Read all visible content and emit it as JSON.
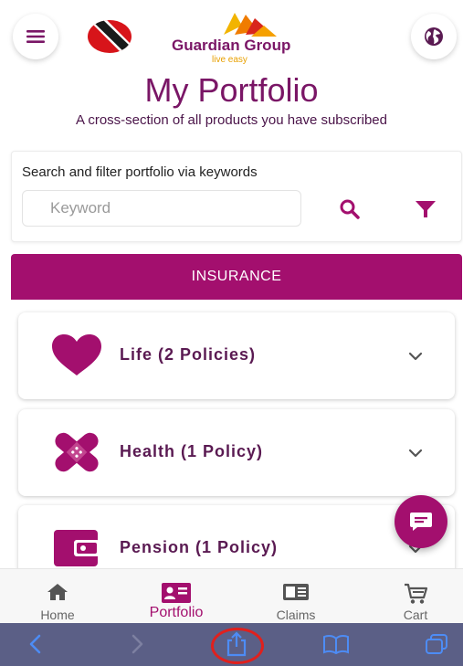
{
  "header": {
    "brand_name": "Guardian Group",
    "tagline": "live easy",
    "menu_icon": "hamburger-menu-icon",
    "globe_icon": "globe-icon",
    "flag_icon": "trinidad-flag-icon"
  },
  "page": {
    "title": "My Portfolio",
    "subtitle": "A cross-section of all products you have subscribed"
  },
  "search": {
    "label": "Search and filter portfolio via keywords",
    "placeholder": "Keyword",
    "value": "",
    "search_icon": "search-icon",
    "filter_icon": "filter-icon"
  },
  "tabs": {
    "active": "INSURANCE"
  },
  "policies": [
    {
      "name": "Life",
      "count": "(2 Policies)",
      "icon": "heart-icon"
    },
    {
      "name": "Health",
      "count": "(1 Policy)",
      "icon": "bandage-icon"
    },
    {
      "name": "Pension",
      "count": "(1 Policy)",
      "icon": "wallet-icon"
    }
  ],
  "fab": {
    "icon": "chat-icon"
  },
  "bottom_nav": [
    {
      "label": "Home",
      "icon": "home-icon",
      "active": false
    },
    {
      "label": "Portfolio",
      "icon": "portfolio-card-icon",
      "active": true
    },
    {
      "label": "Claims",
      "icon": "claims-icon",
      "active": false
    },
    {
      "label": "Cart",
      "icon": "cart-icon",
      "active": false
    }
  ],
  "browser_toolbar": {
    "icons": [
      "back-icon",
      "forward-icon",
      "share-icon",
      "bookmarks-icon",
      "tabs-icon"
    ]
  },
  "colors": {
    "brand": "#a30f6e",
    "title": "#7a1666",
    "browser_bar": "#5b5f86",
    "highlight_ring": "#e0201d"
  }
}
